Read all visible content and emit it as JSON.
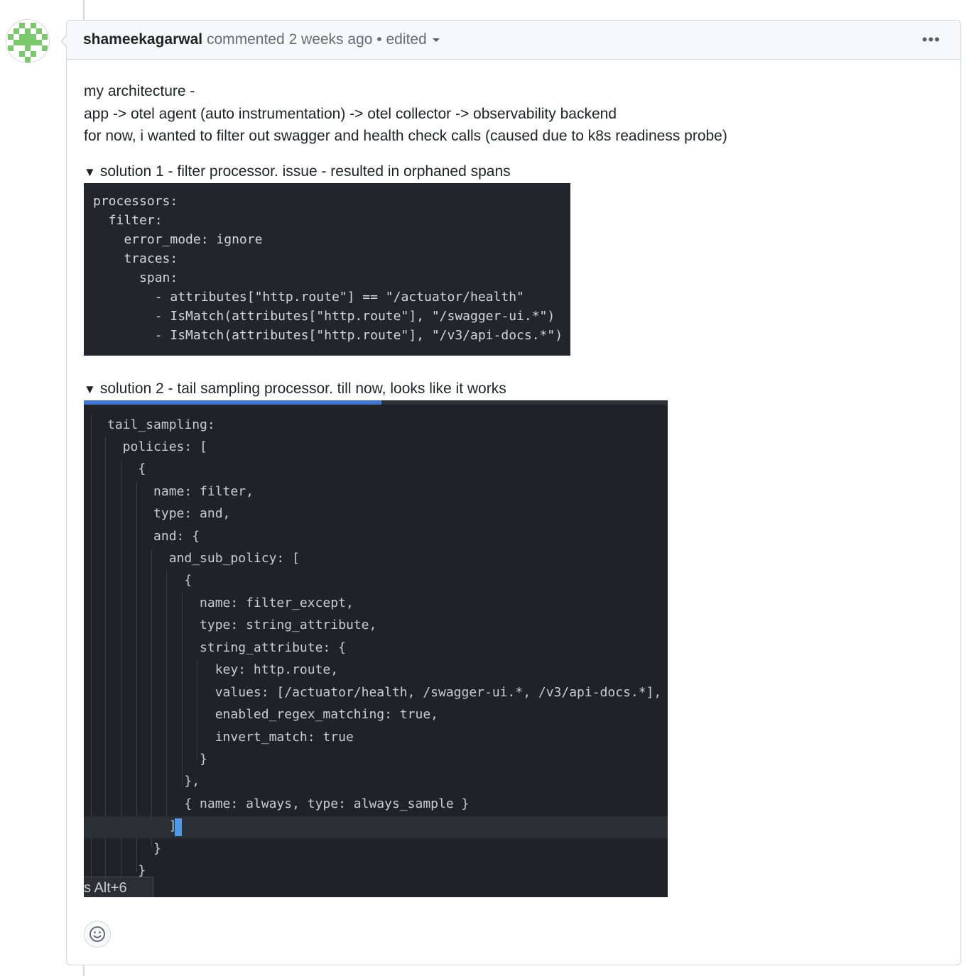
{
  "comment": {
    "author": "shameekagarwal",
    "action": "commented",
    "time": "2 weeks ago",
    "separator": "•",
    "edited": "edited",
    "menu_icon": "kebab-horizontal-icon",
    "body_lines": [
      "my architecture -",
      "app -> otel agent (auto instrumentation) -> otel collector -> observability backend",
      "for now, i wanted to filter out swagger and health check calls (caused due to k8s readiness probe)"
    ],
    "details": [
      {
        "summary": "solution 1 - filter processor. issue - resulted in orphaned spans",
        "code": "processors:\n  filter:\n    error_mode: ignore\n    traces:\n      span:\n        - attributes[\"http.route\"] == \"/actuator/health\"\n        - IsMatch(attributes[\"http.route\"], \"/swagger-ui.*\")\n        - IsMatch(attributes[\"http.route\"], \"/v3/api-docs.*\")"
      },
      {
        "summary": "solution 2 - tail sampling processor. till now, looks like it works",
        "screenshot_lines": [
          "tail_sampling:",
          "  policies: [",
          "    {",
          "      name: filter,",
          "      type: and,",
          "      and: {",
          "        and_sub_policy: [",
          "          {",
          "            name: filter_except,",
          "            type: string_attribute,",
          "            string_attribute: {",
          "              key: http.route,",
          "              values: [/actuator/health, /swagger-ui.*, /v3/api-docs.*],",
          "              enabled_regex_matching: true,",
          "              invert_match: true",
          "            }",
          "          },",
          "          { name: always, type: always_sample }",
          "        ]",
          "      }",
          "    }"
        ],
        "tooltip": "s  Alt+6"
      }
    ],
    "reaction_icon": "smiley-icon"
  },
  "colors": {
    "border": "#d0d7de",
    "header_bg": "#f6f8fa",
    "code_bg": "#22262c",
    "editor_bg": "#1f2328",
    "accent": "#3f79d2"
  }
}
